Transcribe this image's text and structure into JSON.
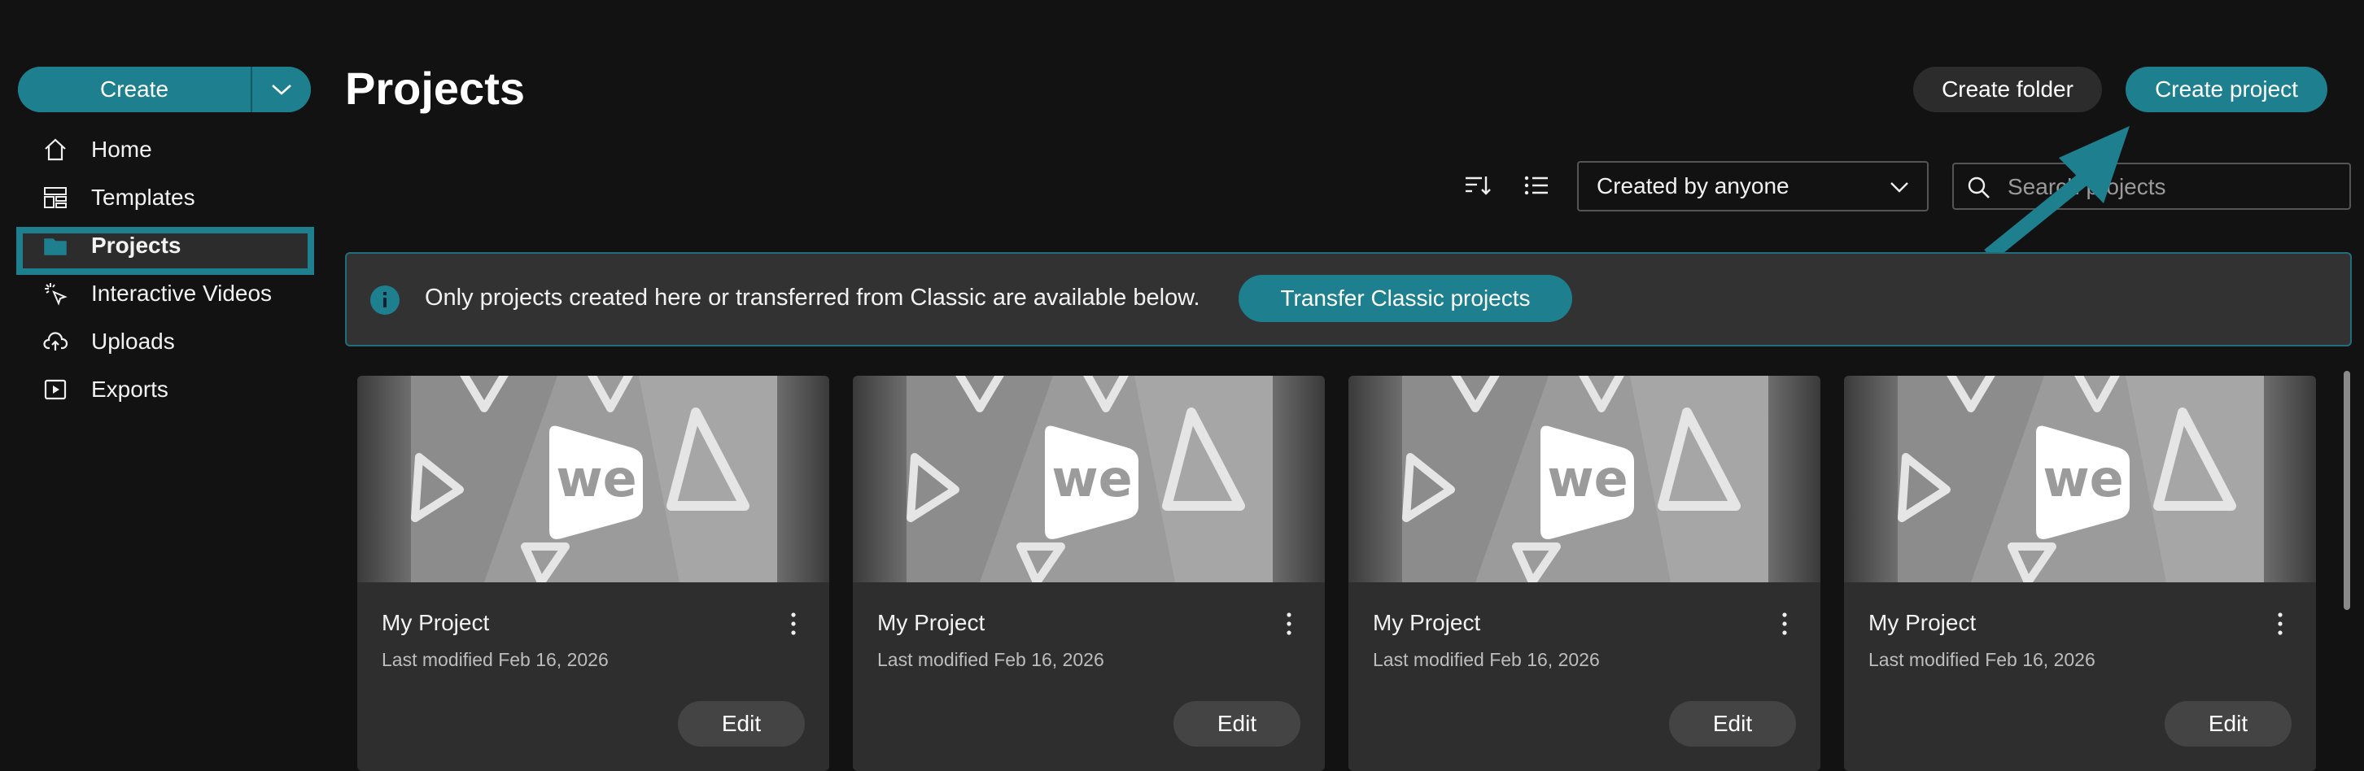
{
  "sidebar": {
    "create_label": "Create",
    "items": [
      {
        "label": "Home",
        "icon": "home-icon"
      },
      {
        "label": "Templates",
        "icon": "templates-icon"
      },
      {
        "label": "Projects",
        "icon": "folder-icon",
        "active": true
      },
      {
        "label": "Interactive Videos",
        "icon": "interactive-icon"
      },
      {
        "label": "Uploads",
        "icon": "upload-cloud-icon"
      },
      {
        "label": "Exports",
        "icon": "export-play-icon"
      }
    ]
  },
  "header": {
    "title": "Projects",
    "create_folder_label": "Create folder",
    "create_project_label": "Create project"
  },
  "toolbar": {
    "filter_value": "Created by anyone",
    "search_placeholder": "Search projects"
  },
  "banner": {
    "text": "Only projects created here or transferred from Classic are available below.",
    "button_label": "Transfer Classic projects"
  },
  "projects": [
    {
      "title": "My Project",
      "meta": "Last modified Feb 16, 2026",
      "edit_label": "Edit"
    },
    {
      "title": "My Project",
      "meta": "Last modified Feb 16, 2026",
      "edit_label": "Edit"
    },
    {
      "title": "My Project",
      "meta": "Last modified Feb 16, 2026",
      "edit_label": "Edit"
    },
    {
      "title": "My Project",
      "meta": "Last modified Feb 16, 2026",
      "edit_label": "Edit"
    }
  ],
  "thumbnail_logo_text": "we",
  "colors": {
    "accent": "#1e7f8f",
    "background": "#121212",
    "card": "#2e2e2e"
  }
}
